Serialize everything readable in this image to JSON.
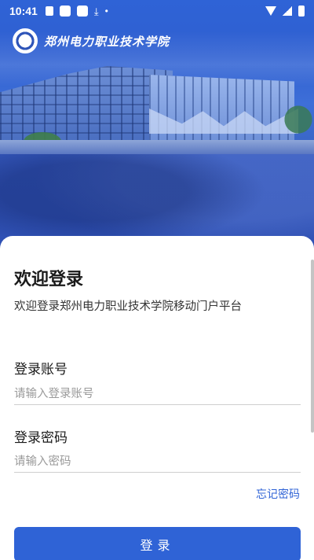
{
  "status_bar": {
    "time": "10:41",
    "left_icons": [
      "app-square-icon",
      "app-square-icon",
      "app-square-icon",
      "download-icon",
      "dot-icon"
    ],
    "right_icons": [
      "wifi-icon",
      "signal-icon",
      "battery-icon"
    ]
  },
  "header": {
    "logo_text": "郑州电力职业技术学院"
  },
  "login": {
    "title": "欢迎登录",
    "subtitle": "欢迎登录郑州电力职业技术学院移动门户平台",
    "account_label": "登录账号",
    "account_placeholder": "请输入登录账号",
    "password_label": "登录密码",
    "password_placeholder": "请输入密码",
    "forgot_password": "忘记密码",
    "login_button": "登录"
  },
  "colors": {
    "accent": "#2f63d6",
    "header_blue": "#2f5fd0"
  }
}
